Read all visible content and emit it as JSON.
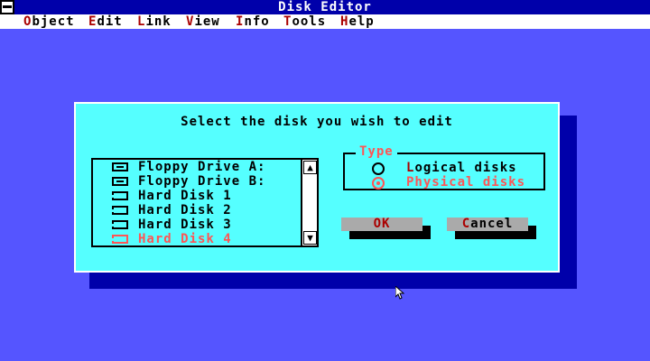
{
  "window": {
    "title": "Disk Editor"
  },
  "menubar": {
    "items": [
      {
        "hotkey": "O",
        "rest": "bject"
      },
      {
        "hotkey": "E",
        "rest": "dit"
      },
      {
        "hotkey": "L",
        "rest": "ink"
      },
      {
        "hotkey": "V",
        "rest": "iew"
      },
      {
        "hotkey": "I",
        "rest": "nfo"
      },
      {
        "hotkey": "T",
        "rest": "ools"
      },
      {
        "hotkey": "H",
        "rest": "elp"
      }
    ]
  },
  "dialog": {
    "title": "Select the disk you wish to edit",
    "disk_list": {
      "items": [
        {
          "label": "Floppy Drive A:",
          "icon": "floppy-drive-icon"
        },
        {
          "label": "Floppy Drive B:",
          "icon": "floppy-drive-icon"
        },
        {
          "label": "Hard Disk 1",
          "icon": "hard-disk-icon"
        },
        {
          "label": "Hard Disk 2",
          "icon": "hard-disk-icon"
        },
        {
          "label": "Hard Disk 3",
          "icon": "hard-disk-icon"
        },
        {
          "label": "Hard Disk 4",
          "icon": "hard-disk-icon",
          "selected": true
        }
      ]
    },
    "type_group": {
      "legend": "Type",
      "options": [
        {
          "hotkey": "L",
          "rest": "ogical disks",
          "selected": false
        },
        {
          "hotkey": "",
          "rest": "Physical disks",
          "selected": true
        }
      ]
    },
    "buttons": {
      "ok": {
        "hotkey": "O",
        "rest": "K"
      },
      "cancel": {
        "hotkey": "C",
        "rest": "ancel"
      }
    }
  },
  "colors": {
    "desktop": "#5555ff",
    "dialog": "#55ffff",
    "titlebar": "#0000aa",
    "highlight": "#ff5555",
    "hotkey": "#aa0000"
  }
}
